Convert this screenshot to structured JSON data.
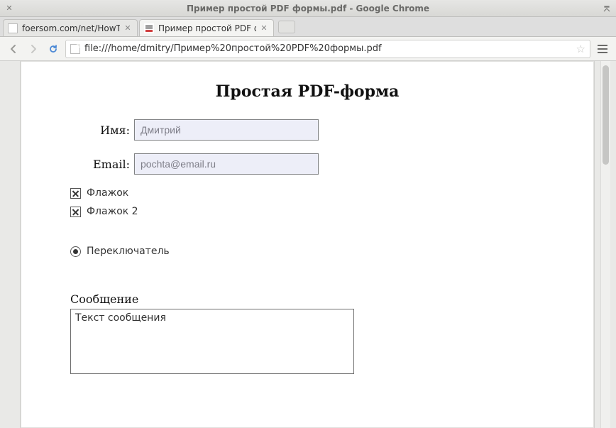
{
  "window": {
    "title": "Пример простой PDF формы.pdf - Google Chrome"
  },
  "tabs": [
    {
      "label": "foersom.com/net/HowTo/"
    },
    {
      "label": "Пример простой PDF фо"
    }
  ],
  "toolbar": {
    "url": "file:///home/dmitry/Пример%20простой%20PDF%20формы.pdf"
  },
  "doc": {
    "heading": "Простая PDF-форма",
    "fields": {
      "name_label": "Имя:",
      "name_value": "Дмитрий",
      "email_label": "Email:",
      "email_value": "pochta@email.ru"
    },
    "checkboxes": [
      {
        "label": "Флажок",
        "checked": true
      },
      {
        "label": "Флажок 2",
        "checked": true
      }
    ],
    "radio": {
      "label": "Переключатель",
      "selected": true
    },
    "message": {
      "label": "Сообщение",
      "value": "Текст сообщения"
    }
  }
}
